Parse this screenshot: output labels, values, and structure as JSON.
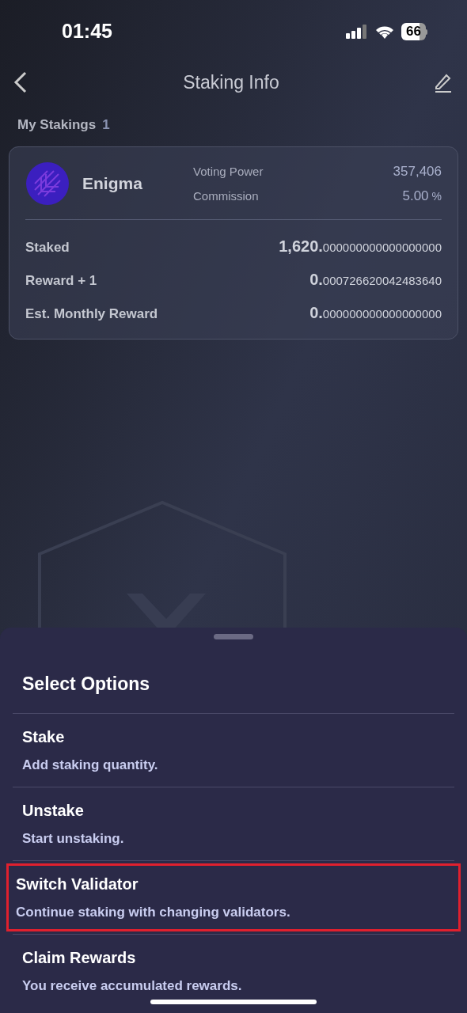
{
  "status_bar": {
    "time": "01:45",
    "battery": "66"
  },
  "header": {
    "title": "Staking Info"
  },
  "section": {
    "title": "My Stakings",
    "count": "1"
  },
  "validator": {
    "name": "Enigma",
    "stats": [
      {
        "label": "Voting Power",
        "value": "357,406"
      },
      {
        "label": "Commission",
        "value": "5.00",
        "unit": "%"
      }
    ]
  },
  "amounts": [
    {
      "label": "Staked",
      "int": "1,620.",
      "frac": "000000000000000000"
    },
    {
      "label": "Reward + 1",
      "int": "0.",
      "frac": "000726620042483640"
    },
    {
      "label": "Est. Monthly Reward",
      "int": "0.",
      "frac": "000000000000000000"
    }
  ],
  "sheet": {
    "title": "Select Options",
    "options": [
      {
        "title": "Stake",
        "description": "Add staking quantity.",
        "highlighted": false
      },
      {
        "title": "Unstake",
        "description": "Start unstaking.",
        "highlighted": false
      },
      {
        "title": "Switch Validator",
        "description": "Continue staking with changing validators.",
        "highlighted": true
      },
      {
        "title": "Claim Rewards",
        "description": "You receive accumulated rewards.",
        "highlighted": false
      }
    ]
  }
}
